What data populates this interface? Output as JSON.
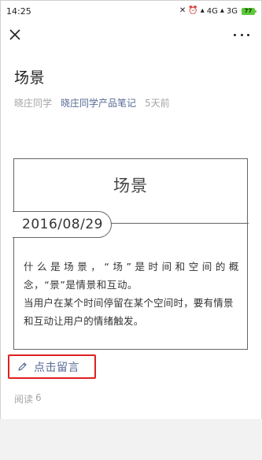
{
  "status_bar": {
    "time": "14:25",
    "icons_text": "✕ ⏰ ⏱",
    "signal_4g": "4G",
    "signal_3g": "3G",
    "battery": "77",
    "icons": [
      "mute-icon",
      "alarm-icon",
      "hd-icon",
      "signal-icon",
      "battery-icon"
    ]
  },
  "nav": {
    "close_icon": "close-icon",
    "more_icon": "more-icon"
  },
  "article": {
    "title": "场景",
    "author": "晓庄同学",
    "account": "晓庄同学产品笔记",
    "time_ago": "5天前"
  },
  "card": {
    "title": "场景",
    "date": "2016/08/29",
    "para1": "什么是场景，“场”是时间和空间的概念，“景”是情景和互动。",
    "para2": "当用户在某个时间停留在某个空间时，要有情景和互动让用户的情绪触发。"
  },
  "comment": {
    "label": "点击留言",
    "icon": "pencil-icon",
    "highlight_color": "#e02020",
    "link_color": "#576b95"
  },
  "stats": {
    "read_label": "阅读",
    "read_count": "6"
  }
}
